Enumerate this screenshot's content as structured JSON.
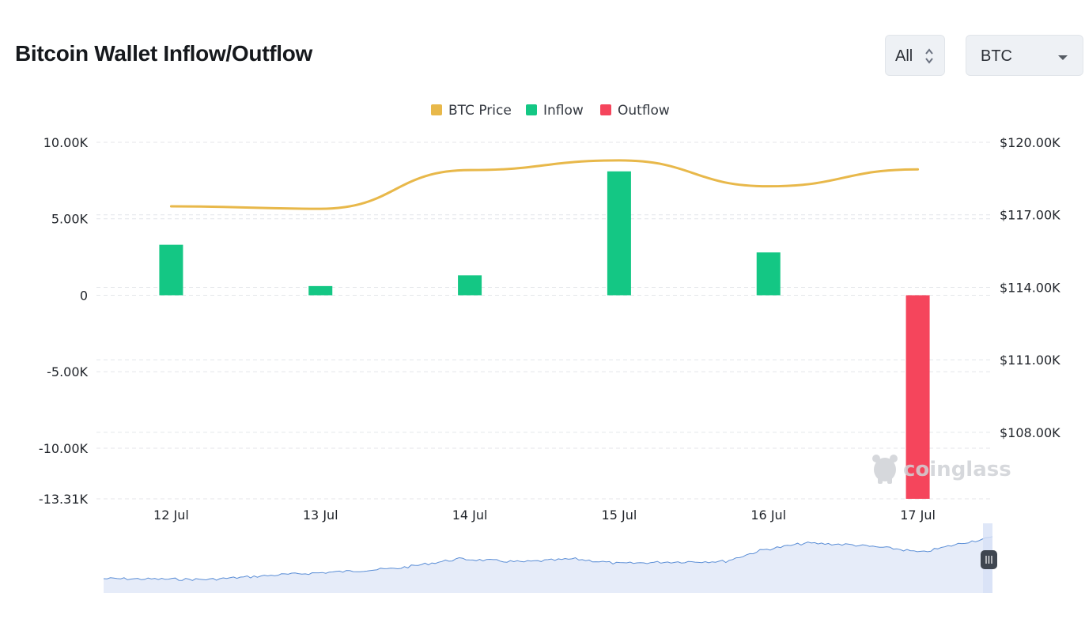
{
  "header": {
    "title": "Bitcoin Wallet Inflow/Outflow",
    "range_value": "All",
    "coin_value": "BTC"
  },
  "watermark": "coinglass",
  "chart_data": {
    "type": "bar",
    "title": "",
    "categories": [
      "12 Jul",
      "13 Jul",
      "14 Jul",
      "15 Jul",
      "16 Jul",
      "17 Jul"
    ],
    "legend": [
      {
        "name": "BTC Price",
        "color": "#e8b84a"
      },
      {
        "name": "Inflow",
        "color": "#14c784"
      },
      {
        "name": "Outflow",
        "color": "#f5455c"
      }
    ],
    "legend_position": "top-center",
    "series": [
      {
        "name": "Inflow",
        "type": "bar",
        "color": "#14c784",
        "values": [
          3300,
          600,
          1300,
          8100,
          2800,
          null
        ]
      },
      {
        "name": "Outflow",
        "type": "bar",
        "color": "#f5455c",
        "values": [
          null,
          null,
          null,
          null,
          null,
          -13310
        ]
      },
      {
        "name": "BTC Price",
        "type": "line",
        "axis": "right",
        "color": "#e8b84a",
        "values": [
          117350,
          117250,
          118850,
          119250,
          118180,
          118880
        ]
      }
    ],
    "y_left": {
      "ylim": [
        -13310,
        10000
      ],
      "ticks": [
        10000,
        5000,
        0,
        -5000,
        -10000,
        -13310
      ],
      "tick_labels": [
        "10.00K",
        "5.00K",
        "0",
        "-5.00K",
        "-10.00K",
        "-13.31K"
      ]
    },
    "y_right": {
      "ylim": [
        105250,
        120000
      ],
      "ticks": [
        120000,
        117000,
        114000,
        111000,
        108000
      ],
      "tick_labels": [
        "$120.00K",
        "$117.00K",
        "$114.00K",
        "$111.00K",
        "$108.00K"
      ]
    },
    "grid": true,
    "navigator": {
      "type": "area",
      "color": "#5b8ed6",
      "fill": "#e6ecf9",
      "handle_label": "III"
    }
  }
}
